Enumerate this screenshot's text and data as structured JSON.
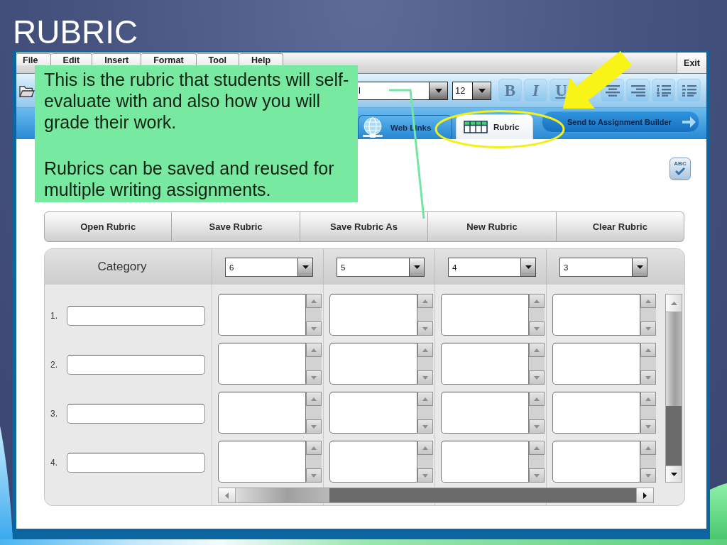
{
  "slide": {
    "title": "RUBRIC"
  },
  "app": {
    "menu": [
      {
        "label": "File"
      },
      {
        "label": "Edit"
      },
      {
        "label": "Insert"
      },
      {
        "label": "Format"
      },
      {
        "label": "Tool"
      },
      {
        "label": "Help"
      }
    ],
    "exit_button": {
      "label": "Exit"
    },
    "toolbar": {
      "font_field": {
        "value": "l"
      },
      "size_field": {
        "value": "12"
      },
      "style_buttons": [
        {
          "kind": "bold",
          "label": "B"
        },
        {
          "kind": "italic",
          "label": "I"
        },
        {
          "kind": "underline",
          "label": "U"
        }
      ],
      "align_buttons": [
        {
          "kind": "align-center"
        },
        {
          "kind": "align-right"
        },
        {
          "kind": "bullet-list"
        },
        {
          "kind": "number-list"
        }
      ]
    },
    "tabs": [
      {
        "kind": "web",
        "label": "Web Links",
        "selected": false
      },
      {
        "kind": "rubric",
        "label": "Rubric",
        "selected": true
      }
    ],
    "send_button": {
      "label": "Send to Assignment Builder"
    },
    "spellcheck_button": {
      "label": "ABC"
    },
    "rubric_buttons": [
      {
        "label": "Open Rubric"
      },
      {
        "label": "Save Rubric"
      },
      {
        "label": "Save Rubric As"
      },
      {
        "label": "New Rubric"
      },
      {
        "label": "Clear Rubric"
      }
    ],
    "rubric_table": {
      "category_header": "Category",
      "score_columns": [
        {
          "value": "6"
        },
        {
          "value": "5"
        },
        {
          "value": "4"
        },
        {
          "value": "3"
        }
      ],
      "rows": [
        {
          "number": "1."
        },
        {
          "number": "2."
        },
        {
          "number": "3."
        },
        {
          "number": "4."
        }
      ]
    }
  },
  "callout": {
    "paragraphs": [
      "This is the rubric that students will self-evaluate with and also how you will grade their work.",
      "Rubrics can be saved and reused for multiple writing assignments."
    ]
  }
}
